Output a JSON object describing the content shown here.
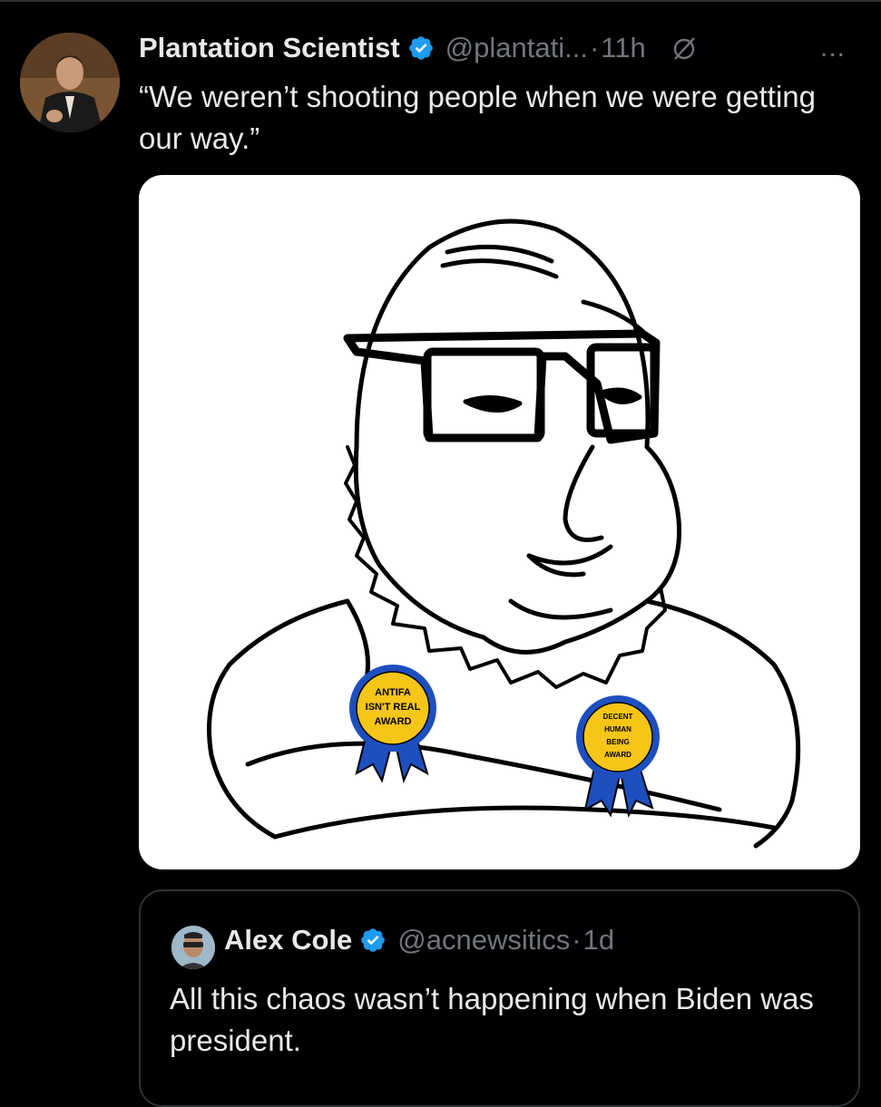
{
  "tweet": {
    "author_name": "Plantation Scientist",
    "handle": "@plantati...",
    "separator": "·",
    "time": "11h",
    "more_icon": "...",
    "text": "“We weren’t shooting people when we were getting our way.”",
    "verified_color": "#1d9bf0",
    "media": {
      "award_left": [
        "ANTIFA",
        "ISN'T REAL",
        "AWARD"
      ],
      "award_right": [
        "DECENT",
        "HUMAN",
        "BEING",
        "AWARD"
      ],
      "ribbon_color": "#1e4fbf",
      "rosette_color": "#f5c518"
    }
  },
  "quoted": {
    "author_name": "Alex Cole",
    "handle": "@acnewsitics",
    "separator": "·",
    "time": "1d",
    "text": "All this chaos wasn’t happening when Biden was president."
  },
  "colors": {
    "background": "#000000",
    "text": "#e7e9ea",
    "muted": "#71767b",
    "border": "#2f3336"
  }
}
